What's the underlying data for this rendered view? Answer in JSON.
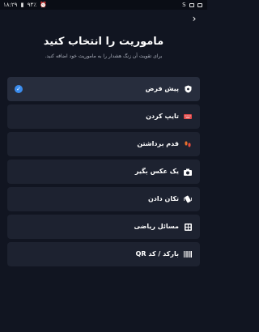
{
  "status_bar": {
    "time": "۱۸:۲۹",
    "battery": "۹۴٪",
    "right_letter": "S"
  },
  "header": {
    "title": "ماموریت را انتخاب کنید",
    "subtitle": "برای تقویت آن زنگ هشدار را به ماموریت خود اضافه کنید."
  },
  "missions": [
    {
      "label": "پیش فرض",
      "icon": "shield-icon",
      "selected": true
    },
    {
      "label": "تایپ کردن",
      "icon": "keyboard-icon",
      "selected": false
    },
    {
      "label": "قدم برداشتن",
      "icon": "footsteps-icon",
      "selected": false
    },
    {
      "label": "یک عکس بگیر",
      "icon": "camera-icon",
      "selected": false
    },
    {
      "label": "تکان دادن",
      "icon": "shake-phone-icon",
      "selected": false
    },
    {
      "label": "مسائل ریاضی",
      "icon": "calculator-icon",
      "selected": false
    },
    {
      "label": "بارکد / کد QR",
      "icon": "barcode-icon",
      "selected": false
    }
  ],
  "colors": {
    "background": "#111521",
    "item_background": "#1d2230",
    "check_blue": "#3b8ced",
    "keyboard_red": "#e04848",
    "footsteps_orange": "#e8722c"
  }
}
